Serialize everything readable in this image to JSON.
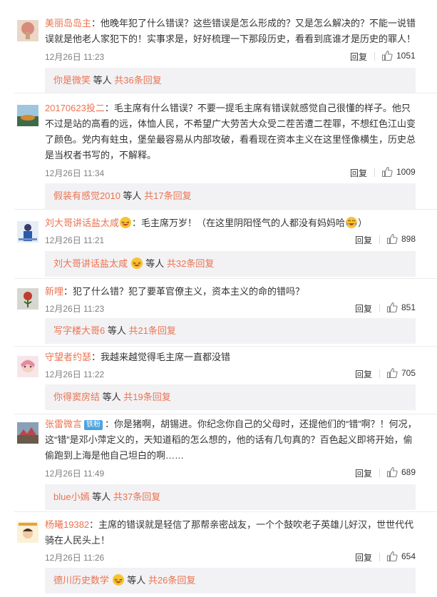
{
  "actions": {
    "reply_label": "回复",
    "etc_label": " 等人 "
  },
  "colors": {
    "accent": "#eb7350",
    "sub_bg": "#f2f2f5",
    "badge": "#4ba3e1"
  },
  "comments": [
    {
      "username": "美丽岛岛主",
      "text": "：他晚年犯了什么错误？这些错误是怎么形成的？又是怎么解决的？不能一说错误就是他老人家犯下的！实事求是，好好梳理一下那段历史，看看到底谁才是历史的罪人！",
      "time": "12月26日 11:23",
      "likes": "1051",
      "sub_user": "你是微笑",
      "sub_count": "共36条回复"
    },
    {
      "username": "20170623投二",
      "text": "：毛主席有什么错误？不要一提毛主席有错误就感觉自己很懂的样子。他只不过是站的高看的远，体恤人民，不希望广大劳苦大众受二茬苦遭二茬罪，不想红色江山变了颜色。党内有蛀虫，堡垒最容易从内部攻破，看看现在资本主义在这里怪像横生，历史总是当权者书写的，不解释。",
      "time": "12月26日 11:34",
      "likes": "1009",
      "sub_user": "假装有感觉2010",
      "sub_count": "共17条回复"
    },
    {
      "username": "刘大哥讲话盐太咸",
      "text": "：毛主席万岁！（在这里阴阳怪气的人都没有妈妈哈",
      "text_end": "）",
      "time": "12月26日 11:21",
      "likes": "898",
      "sub_user": "刘大哥讲话盐太咸",
      "sub_count": "共32条回复"
    },
    {
      "username": "新哩",
      "text": "：犯了什么错？犯了要革官僚主义，资本主义的命的错吗？",
      "time": "12月26日 11:23",
      "likes": "851",
      "sub_user": "写字楼大哥6",
      "sub_count": "共21条回复"
    },
    {
      "username": "守望者约瑟",
      "text": "：我越来越觉得毛主席一直都没错",
      "time": "12月26日 11:22",
      "likes": "705",
      "sub_user": "你得窦房结",
      "sub_count": "共19条回复"
    },
    {
      "username": "张雷微言",
      "badge": "铁粉",
      "text": "：你是猪啊，胡锡进。你纪念你自己的父母时，还提他们的“错”啊？！何况，这“错”是邓小萍定义的，天知道稻的怎么想的，他的话有几句真的？百色起义即将开始，偷偷跑到上海是他自己坦白的啊……",
      "time": "12月26日 11:49",
      "likes": "689",
      "sub_user": "blue小嫣",
      "sub_count": "共37条回复"
    },
    {
      "username": "杨曦19382",
      "text": "：主席的错误就是轻信了那帮亲密战友，一个个鼓吹老子英雄儿好汉，世世代代骑在人民头上！",
      "time": "12月26日 11:26",
      "likes": "654",
      "sub_user": "德川历史数学",
      "sub_count": "共26条回复"
    }
  ]
}
